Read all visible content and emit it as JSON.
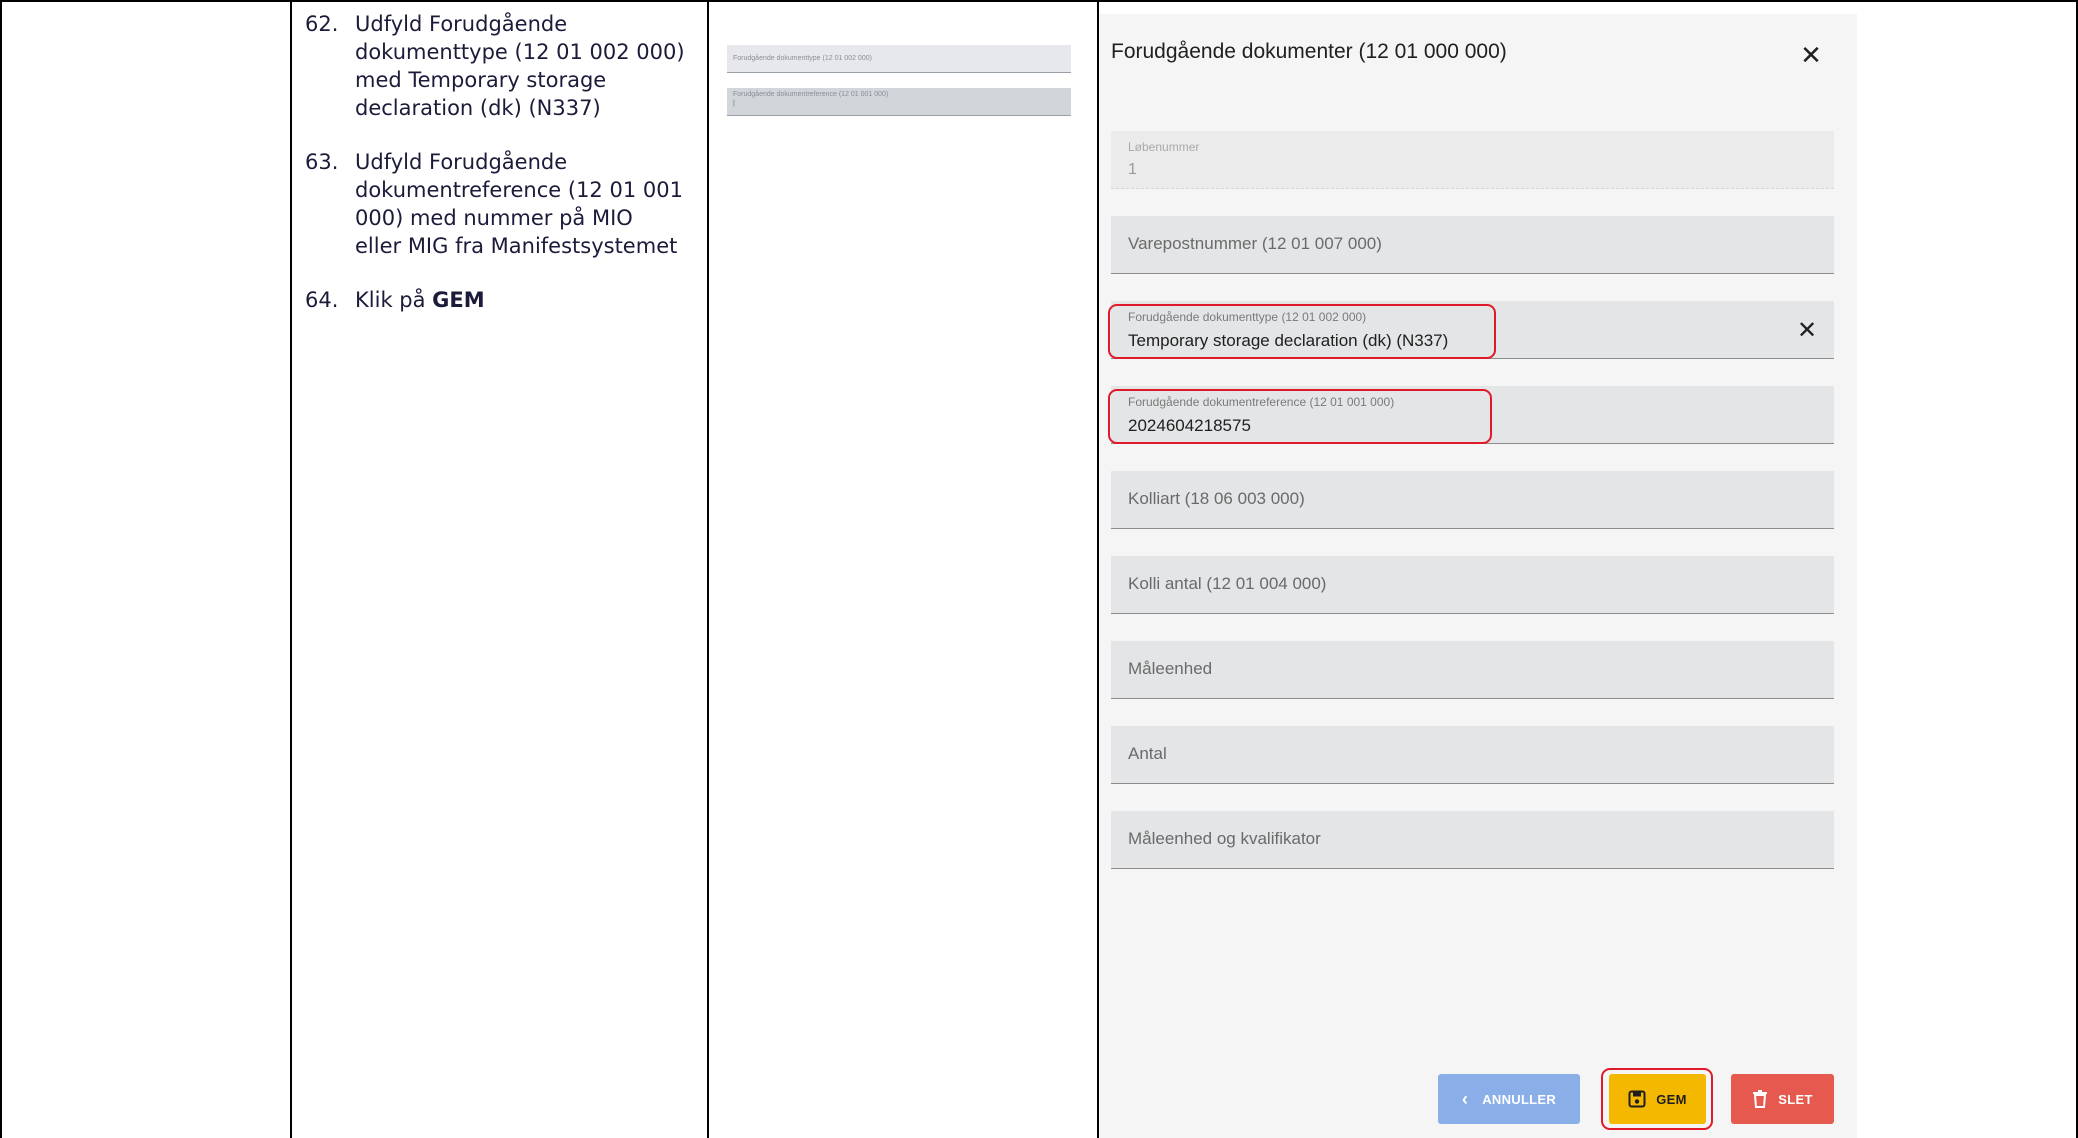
{
  "instructions": {
    "steps": [
      {
        "number": "62.",
        "text": "Udfyld Forudgående dokumenttype (12 01 002 000) med Temporary storage declaration (dk) (N337)"
      },
      {
        "number": "63.",
        "text": "Udfyld Forudgående dokumentreference (12 01 001 000) med nummer på MIO eller MIG fra Manifestsystemet"
      },
      {
        "number": "64.",
        "text_prefix": "Klik på",
        "text_bold": "GEM"
      }
    ]
  },
  "thumbnail": {
    "field1_label": "Forudgående dokumenttype (12 01 002 000)",
    "field2_label": "Forudgående dokumentreference (12 01 001 000)",
    "field2_value": "|"
  },
  "dialog": {
    "title": "Forudgående dokumenter (12 01 000 000)",
    "close_icon": "close-icon",
    "fields": {
      "lobenummer": {
        "label": "Løbenummer",
        "value": "1"
      },
      "varepostnummer": {
        "placeholder": "Varepostnummer (12 01 007 000)"
      },
      "dokumenttype": {
        "label": "Forudgående dokumenttype (12 01 002 000)",
        "value": "Temporary storage declaration (dk) (N337)"
      },
      "dokumentreference": {
        "label": "Forudgående dokumentreference (12 01 001 000)",
        "value": "2024604218575"
      },
      "kolliart": {
        "placeholder": "Kolliart (18 06 003 000)"
      },
      "kolli_antal": {
        "placeholder": "Kolli antal (12 01 004 000)"
      },
      "maaleenhed": {
        "placeholder": "Måleenhed"
      },
      "antal": {
        "placeholder": "Antal"
      },
      "maaleenhed_kvalifikator": {
        "placeholder": "Måleenhed og kvalifikator"
      }
    },
    "buttons": {
      "cancel": "ANNULLER",
      "save": "GEM",
      "delete": "SLET"
    }
  },
  "colors": {
    "highlight": "#e01a2a",
    "cancel_button": "#8aaee8",
    "save_button": "#f5b800",
    "delete_button": "#e5594e"
  }
}
